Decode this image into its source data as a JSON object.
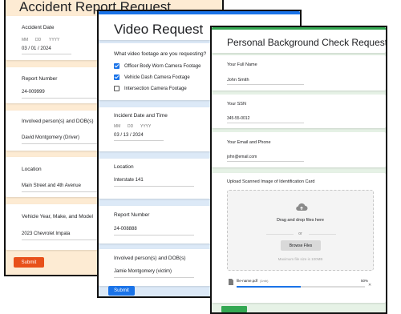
{
  "accident": {
    "title": "Accident Report Request",
    "date_label": "Accident Date",
    "date_mm": "MM",
    "date_dd": "DD",
    "date_yyyy": "YYYY",
    "date_value": "03  /  01  /  2024",
    "report_label": "Report Number",
    "report_value": "24-009999",
    "persons_label": "Involved person(s) and DOB(s)",
    "persons_value": "David Montgomery (Driver)",
    "location_label": "Location",
    "location_value": "Main Street and 4th Avenue",
    "vehicle_label": "Vehicle Year, Make, and Model",
    "vehicle_value": "2023 Chevrolet Impala",
    "submit": "Submit",
    "accent": "#f5a623",
    "submit_color": "#e8501a"
  },
  "video": {
    "title": "Video Request",
    "footage_label": "What video footage are you requesting?",
    "options": [
      {
        "label": "Officer Body Worn Camera Footage",
        "checked": true
      },
      {
        "label": "Vehicle Dash Camera Footage",
        "checked": true
      },
      {
        "label": "Intersection Camera Footage",
        "checked": false
      }
    ],
    "incident_label": "Incident Date and Time",
    "date_mm": "MM",
    "date_dd": "DD",
    "date_yyyy": "YYYY",
    "date_value": "03  /  13  /  2024",
    "location_label": "Location",
    "location_value": "Interstate 141",
    "report_label": "Report Number",
    "report_value": "24-008888",
    "persons_label": "Involved person(s) and DOB(s)",
    "persons_value": "Jamie Montgomery (victim)",
    "submit": "Submit",
    "accent": "#1a73e8"
  },
  "background": {
    "title": "Personal Background Check Request",
    "name_label": "Your Full Name",
    "name_value": "John Smith",
    "ssn_label": "Your SSN",
    "ssn_value": "345-55-0012",
    "email_label": "Your Email and Phone",
    "email_value": "john@email.com",
    "upload_label": "Upload Scanned Image of Identification Card",
    "drop_text": "Drag and drop files here",
    "or_text": "or",
    "browse": "Browse Files",
    "max_size": "Maximum file size is 100MB",
    "file_name": "file-name.pdf",
    "file_size": "(1mb)",
    "progress_text": "50%",
    "progress": 0.5,
    "close_glyph": "✕",
    "icons": [
      "cloud-upload-icon",
      "file-icon",
      "close-icon"
    ],
    "accent": "#34a853"
  }
}
